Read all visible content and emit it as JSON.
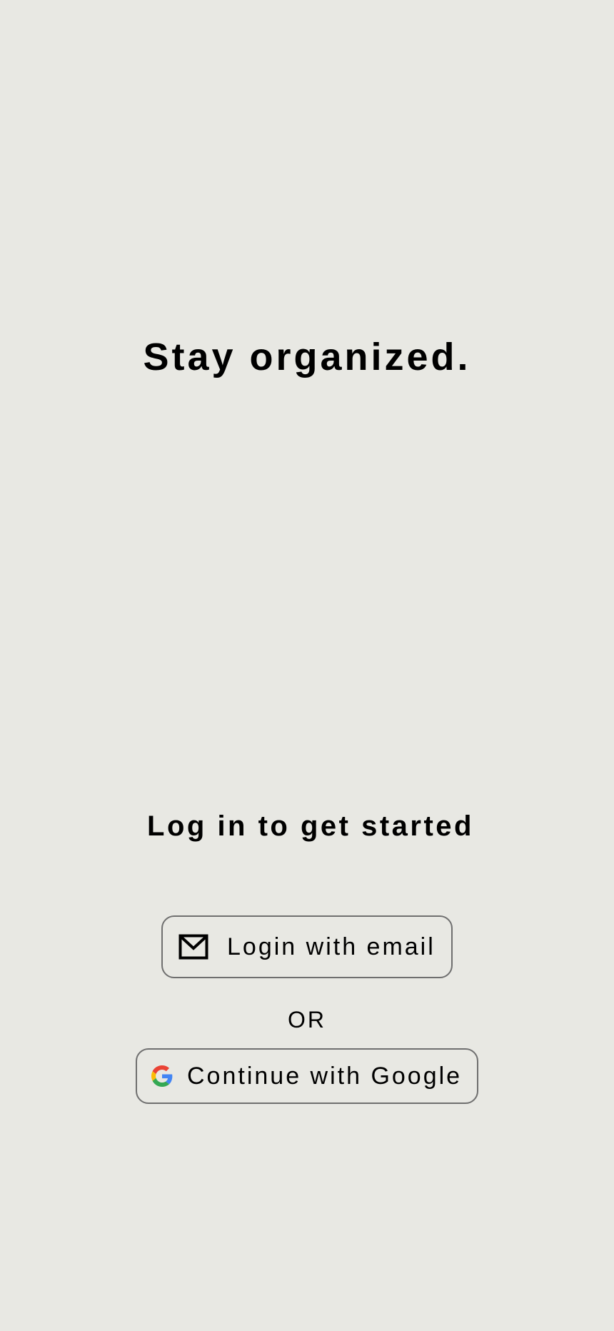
{
  "tagline": "Stay organized.",
  "subheading": "Log in to get started",
  "email_button": {
    "label": "Login with email",
    "icon": "mail-icon"
  },
  "divider_text": "OR",
  "google_button": {
    "label": "Continue with Google",
    "icon": "google-icon"
  },
  "colors": {
    "background": "#e8e8e3",
    "text": "#000000",
    "button_border": "#6f6f6f",
    "google_blue": "#4285F4",
    "google_red": "#EA4335",
    "google_yellow": "#FBBC05",
    "google_green": "#34A853"
  }
}
